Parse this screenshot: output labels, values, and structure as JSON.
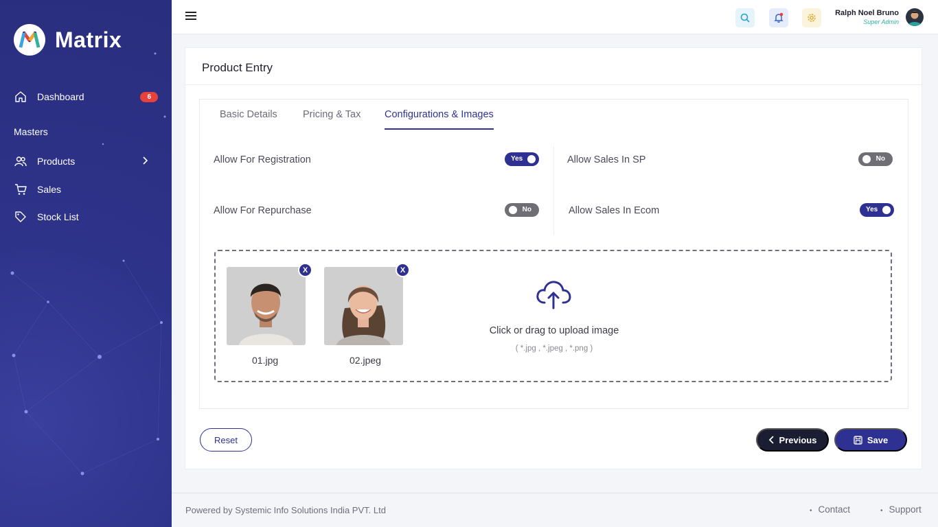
{
  "brand": {
    "name": "Matrix"
  },
  "sidebar": {
    "items": [
      {
        "label": "Dashboard",
        "icon": "home-icon",
        "badge": "6"
      },
      {
        "label": "Products",
        "icon": "users-icon"
      },
      {
        "label": "Sales",
        "icon": "cart-icon"
      },
      {
        "label": "Stock List",
        "icon": "tag-icon"
      }
    ],
    "section": "Masters"
  },
  "topbar": {
    "icons": [
      "menu-icon",
      "search-icon",
      "bell-icon",
      "gear-icon"
    ],
    "user": {
      "name": "Ralph Noel Bruno",
      "role": "Super Admin"
    }
  },
  "page": {
    "title": "Product Entry",
    "tabs": [
      {
        "label": "Basic Details",
        "active": false
      },
      {
        "label": "Pricing & Tax",
        "active": false
      },
      {
        "label": "Configurations & Images",
        "active": true
      }
    ],
    "options": [
      {
        "label": "Allow For Registration",
        "value": "Yes",
        "on": true
      },
      {
        "label": "Allow Sales In SP",
        "value": "No",
        "on": false
      },
      {
        "label": "Allow For Repurchase",
        "value": "No",
        "on": false
      },
      {
        "label": "Allow Sales In Ecom",
        "value": "Yes",
        "on": true
      }
    ],
    "upload": {
      "files": [
        {
          "name": "01.jpg",
          "remove": "X"
        },
        {
          "name": "02.jpeg",
          "remove": "X"
        }
      ],
      "prompt": "Click or drag to upload image",
      "hint": "( *.jpg , *.jpeg , *.png )"
    },
    "buttons": {
      "reset": "Reset",
      "previous": "Previous",
      "save": "Save"
    }
  },
  "footer": {
    "copyright": "Powered by Systemic Info Solutions India PVT. Ltd",
    "links": [
      "Contact",
      "Support"
    ]
  },
  "colors": {
    "primary": "#2e3192",
    "dark": "#1b1d33",
    "badge": "#e8413c",
    "role": "#2fb39a"
  }
}
